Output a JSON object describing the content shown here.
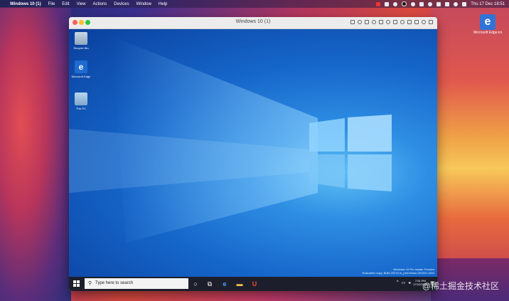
{
  "menubar": {
    "app_name": "Windows 10 (1)",
    "items": [
      "File",
      "Edit",
      "View",
      "Actions",
      "Devices",
      "Window",
      "Help"
    ],
    "clock": "Thu 17 Dec  18:51"
  },
  "mac_desktop": {
    "edge_shortcut_label": "Microsoft Edge.ini"
  },
  "vm_window": {
    "title": "Windows 10 (1)"
  },
  "win_desktop": {
    "icons": [
      {
        "label": "Recycle Bin"
      },
      {
        "label": "Microsoft Edge"
      },
      {
        "label": "This PC"
      }
    ],
    "watermark_line1": "Windows 10 Pro Insider Preview",
    "watermark_line2": "Evaluation copy. Build 20270.rs_prerelease.201202-1644"
  },
  "taskbar": {
    "search_placeholder": "Type here to search",
    "clock_time": "7:51 PM",
    "clock_date": "17/12/2020"
  },
  "page_watermark": "@稀土掘金技术社区",
  "colors": {
    "win_blue": "#1565c9",
    "taskbar": "#1c1f2b",
    "traffic_close": "#fe5f57",
    "traffic_min": "#febc2e",
    "traffic_max": "#28c840"
  }
}
